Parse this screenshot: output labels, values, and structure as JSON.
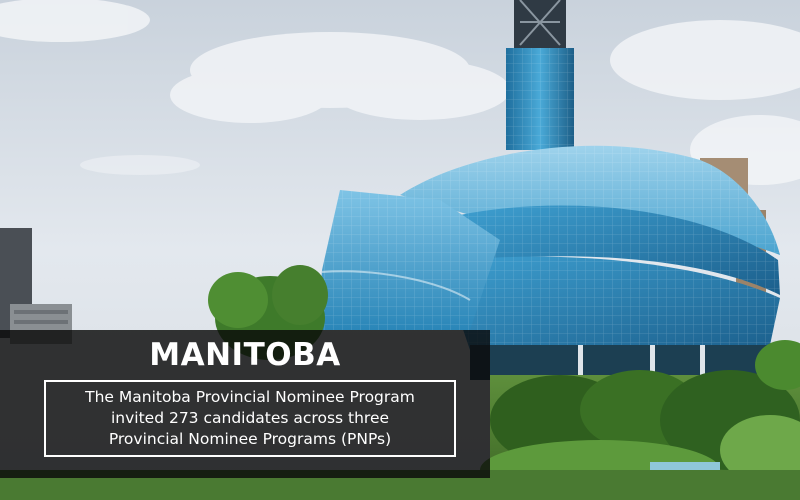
{
  "headline": "MANITOBA",
  "description_lines": [
    "The Manitoba Provincial Nominee Program",
    "invited 273 candidates across three",
    "Provincial Nominee Programs (PNPs)"
  ],
  "colors": {
    "panel": "#0a0a0a",
    "text": "#ffffff",
    "glass": "#3d9fcf",
    "sky": "#dfe5ec"
  }
}
